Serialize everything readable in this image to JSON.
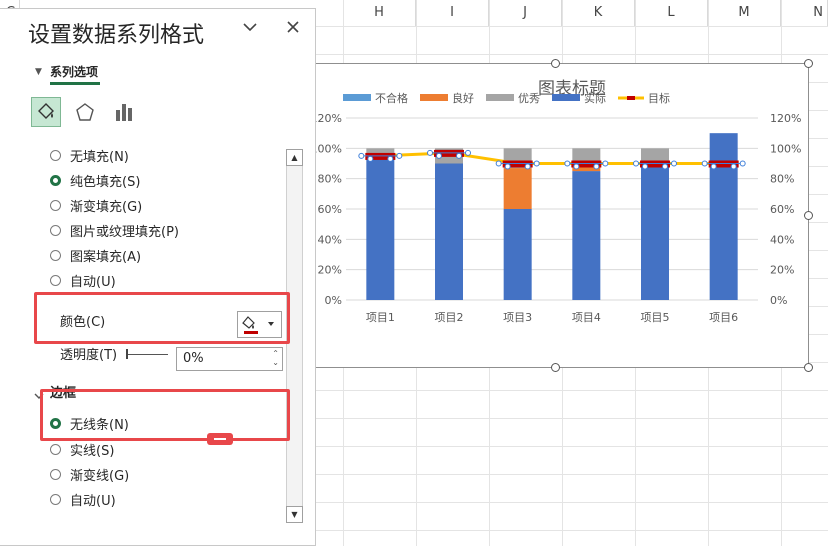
{
  "sheet": {
    "columns": [
      "C",
      "H",
      "I",
      "J",
      "K",
      "L",
      "M",
      "N"
    ]
  },
  "pane": {
    "title": "设置数据系列格式",
    "section_label": "系列选项",
    "fill_options": [
      {
        "label": "无填充(N)",
        "selected": false
      },
      {
        "label": "纯色填充(S)",
        "selected": true
      },
      {
        "label": "渐变填充(G)",
        "selected": false
      },
      {
        "label": "图片或纹理填充(P)",
        "selected": false
      },
      {
        "label": "图案填充(A)",
        "selected": false
      },
      {
        "label": "自动(U)",
        "selected": false
      }
    ],
    "color_label": "颜色(C)",
    "color_value": "#c00000",
    "transparency_label": "透明度(T)",
    "transparency_value": "0%",
    "border_heading": "边框",
    "border_options": [
      {
        "label": "无线条(N)",
        "selected": true
      },
      {
        "label": "实线(S)",
        "selected": false
      },
      {
        "label": "渐变线(G)",
        "selected": false
      },
      {
        "label": "自动(U)",
        "selected": false
      }
    ]
  },
  "chart_data": {
    "type": "bar",
    "title": "图表标题",
    "categories": [
      "项目1",
      "项目2",
      "项目3",
      "项目4",
      "项目5",
      "项目6"
    ],
    "ylim": [
      0,
      1.2
    ],
    "y_ticks": [
      "0%",
      "20%",
      "40%",
      "60%",
      "80%",
      "100%",
      "120%"
    ],
    "stacked": true,
    "grid": true,
    "legend_position": "top",
    "series": [
      {
        "name": "不合格",
        "color": "#5b9bd5",
        "values": [
          0,
          0,
          0,
          0,
          0,
          0
        ]
      },
      {
        "name": "良好",
        "color": "#ed7d31",
        "values": [
          0,
          0,
          0.27,
          0.03,
          0,
          0
        ]
      },
      {
        "name": "优秀",
        "color": "#a5a5a5",
        "values": [
          0.07,
          0.1,
          0.13,
          0.12,
          0.1,
          0
        ]
      },
      {
        "name": "实际",
        "color": "#4472c4",
        "values": [
          0.93,
          0.9,
          0.6,
          0.85,
          0.9,
          1.1
        ]
      },
      {
        "name": "目标",
        "color": "#ffc000",
        "type": "line",
        "values": [
          0.95,
          0.97,
          0.9,
          0.9,
          0.9,
          0.9
        ]
      }
    ],
    "target_marker_color": "#c00000"
  }
}
